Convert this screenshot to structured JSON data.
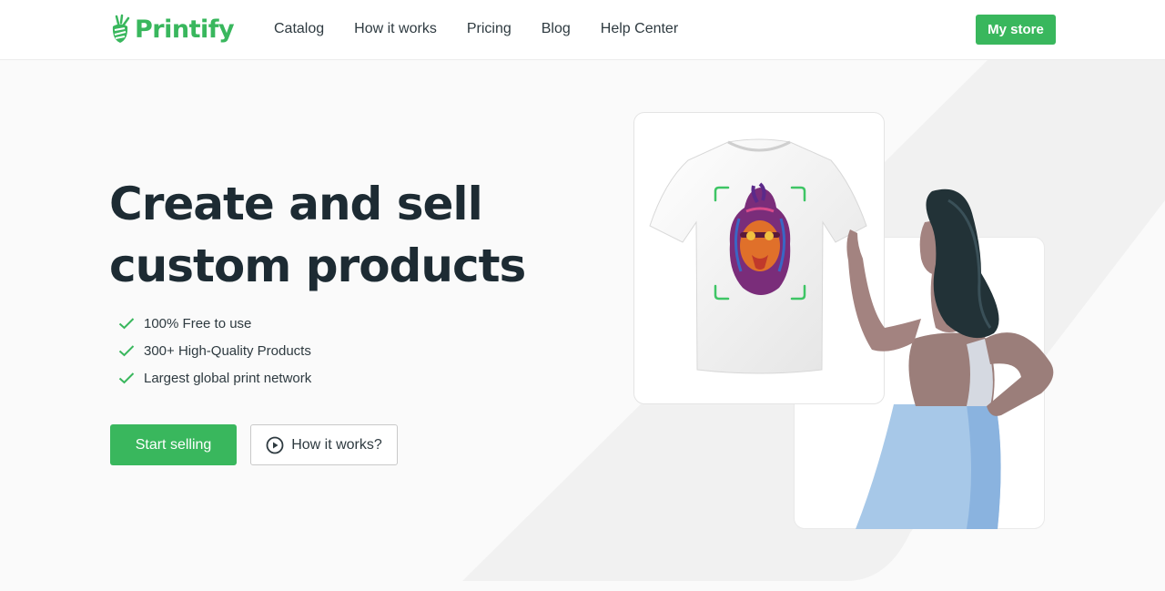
{
  "brand": {
    "name": "Printify",
    "accent": "#39b75d"
  },
  "nav": {
    "items": [
      "Catalog",
      "How it works",
      "Pricing",
      "Blog",
      "Help Center"
    ],
    "my_store_label": "My store"
  },
  "hero": {
    "headline_line1": "Create and sell",
    "headline_line2": "custom products",
    "features": [
      "100% Free to use",
      "300+ High-Quality Products",
      "Largest global print network"
    ],
    "start_selling_label": "Start selling",
    "how_it_works_label": "How it works?"
  },
  "icons": [
    "printify-logo-icon",
    "check-icon",
    "play-circle-icon"
  ]
}
